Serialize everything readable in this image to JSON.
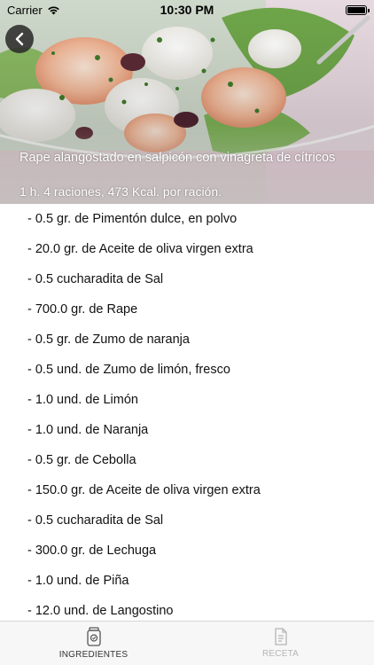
{
  "status_bar": {
    "carrier": "Carrier",
    "time": "10:30 PM"
  },
  "recipe": {
    "title": "Rape alangostado en salpicón con vinagreta de cítricos",
    "details": "1 h. 4 raciones, 473 Kcal. por ración."
  },
  "ingredients": [
    "0.5 gr. de Pimentón dulce, en polvo",
    "20.0 gr. de Aceite de oliva virgen extra",
    "0.5 cucharadita de Sal",
    "700.0 gr. de Rape",
    "0.5 gr. de Zumo de naranja",
    "0.5 und. de Zumo de limón, fresco",
    "1.0 und. de Limón",
    "1.0 und. de Naranja",
    "0.5 gr. de Cebolla",
    "150.0 gr. de Aceite de oliva virgen extra",
    "0.5 cucharadita de Sal",
    "300.0 gr. de Lechuga",
    "1.0 und. de Piña",
    "12.0 und. de Langostino"
  ],
  "tabs": [
    {
      "label": "INGREDIENTES",
      "icon": "ingredients-jar-icon",
      "active": true
    },
    {
      "label": "RECETA",
      "icon": "recipe-document-icon",
      "active": false
    }
  ]
}
